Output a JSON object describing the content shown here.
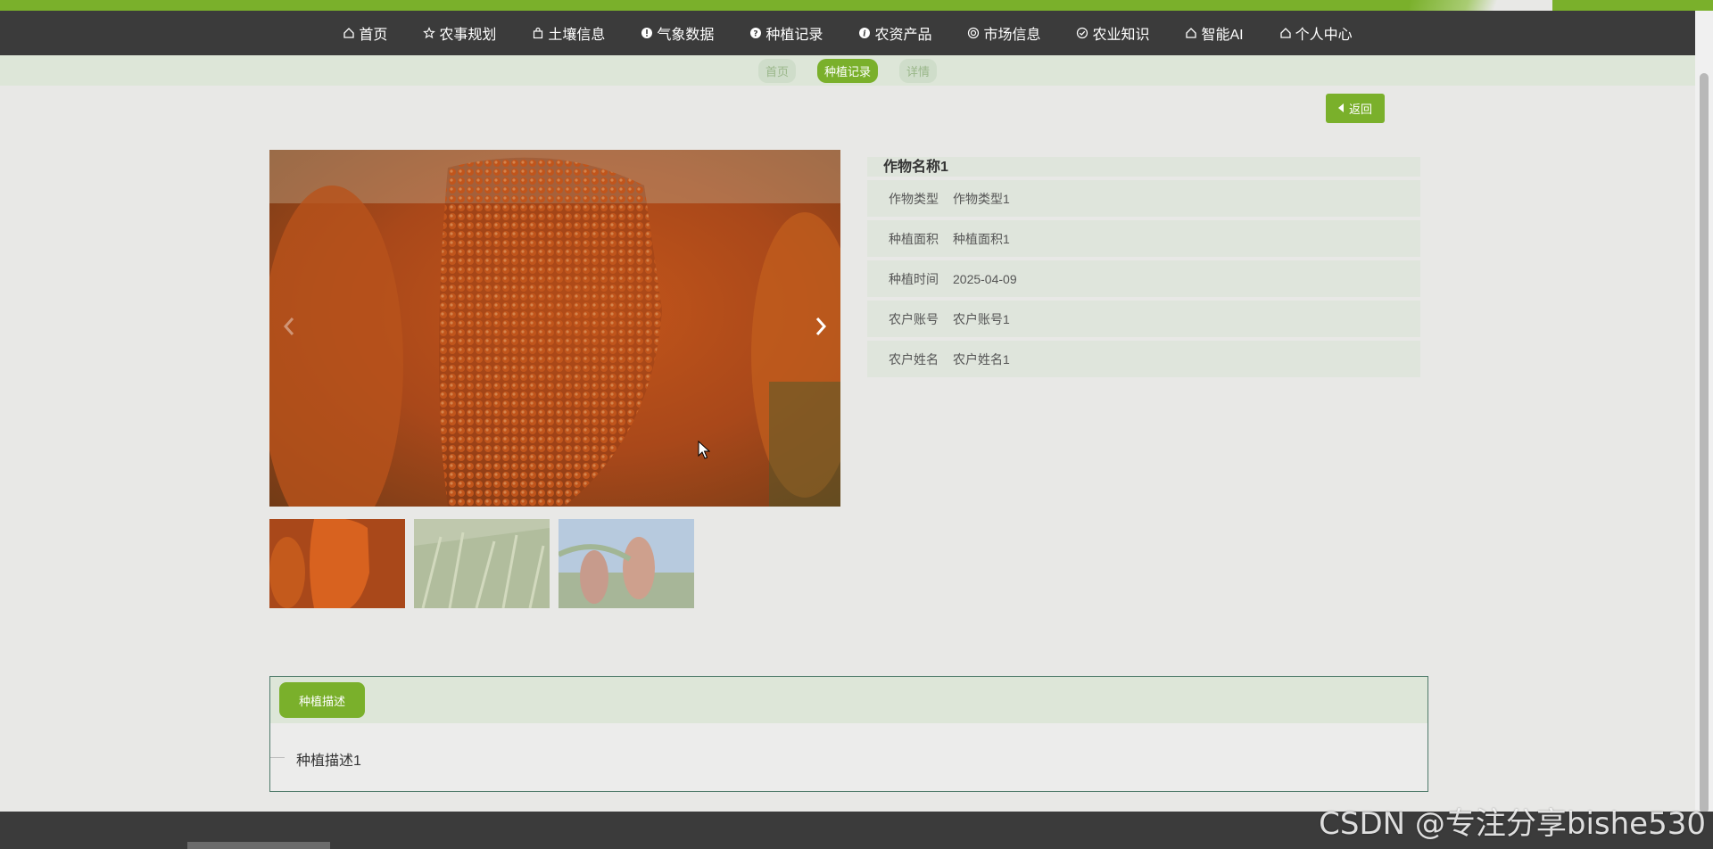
{
  "nav": {
    "items": [
      {
        "label": "首页",
        "icon": "home-icon"
      },
      {
        "label": "农事规划",
        "icon": "star-icon"
      },
      {
        "label": "土壤信息",
        "icon": "bag-icon"
      },
      {
        "label": "气象数据",
        "icon": "alert-icon"
      },
      {
        "label": "种植记录",
        "icon": "help-icon"
      },
      {
        "label": "农资产品",
        "icon": "info-icon"
      },
      {
        "label": "市场信息",
        "icon": "globe-icon"
      },
      {
        "label": "农业知识",
        "icon": "check-circle-icon"
      },
      {
        "label": "智能AI",
        "icon": "home-icon"
      },
      {
        "label": "个人中心",
        "icon": "home-icon"
      }
    ]
  },
  "breadcrumb": [
    "首页",
    "种植记录",
    "详情"
  ],
  "back_button": "返回",
  "detail": {
    "title": "作物名称1",
    "fields": [
      {
        "label": "作物类型",
        "value": "作物类型1"
      },
      {
        "label": "种植面积",
        "value": "种植面积1"
      },
      {
        "label": "种植时间",
        "value": "2025-04-09"
      },
      {
        "label": "农户账号",
        "value": "农户账号1"
      },
      {
        "label": "农户姓名",
        "value": "农户姓名1"
      }
    ]
  },
  "description": {
    "tab_label": "种植描述",
    "text": "种植描述1"
  },
  "watermark": "CSDN @专注分享bishe530",
  "colors": {
    "accent": "#7ab02b",
    "navbar": "#3b3b3b",
    "band": "#dde6d8"
  }
}
